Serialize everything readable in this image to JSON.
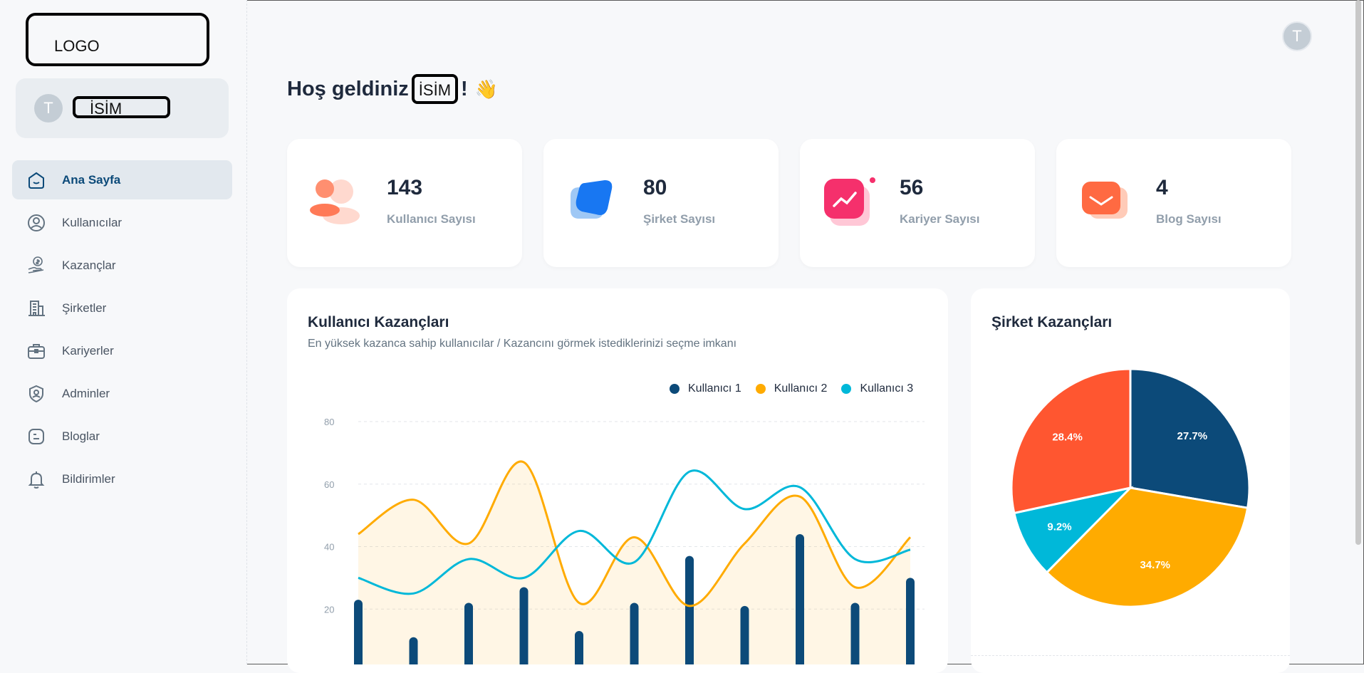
{
  "sidebar": {
    "logo": "LOGO",
    "profile": {
      "avatar_initial": "T",
      "name": "İSİM"
    },
    "items": [
      {
        "label": "Ana Sayfa",
        "icon": "home-icon",
        "active": true
      },
      {
        "label": "Kullanıcılar",
        "icon": "user-circle-icon",
        "active": false
      },
      {
        "label": "Kazançlar",
        "icon": "money-hand-icon",
        "active": false
      },
      {
        "label": "Şirketler",
        "icon": "building-icon",
        "active": false
      },
      {
        "label": "Kariyerler",
        "icon": "briefcase-icon",
        "active": false
      },
      {
        "label": "Adminler",
        "icon": "shield-user-icon",
        "active": false
      },
      {
        "label": "Bloglar",
        "icon": "blog-icon",
        "active": false
      },
      {
        "label": "Bildirimler",
        "icon": "bell-icon",
        "active": false
      }
    ]
  },
  "header": {
    "avatar_initial": "T",
    "welcome_prefix": "Hoş geldiniz",
    "welcome_name": "İSİM",
    "welcome_suffix": "!",
    "wave": "👋"
  },
  "stats": [
    {
      "value": "143",
      "label": "Kullanıcı Sayısı",
      "icon": "users-icon"
    },
    {
      "value": "80",
      "label": "Şirket Sayısı",
      "icon": "company-icon"
    },
    {
      "value": "56",
      "label": "Kariyer Sayısı",
      "icon": "career-chart-icon"
    },
    {
      "value": "4",
      "label": "Blog Sayısı",
      "icon": "blog-mail-icon"
    }
  ],
  "user_earnings": {
    "title": "Kullanıcı Kazançları",
    "subtitle": "En yüksek kazanca sahip kullanıcılar / Kazancını görmek istediklerinizi seçme imkanı"
  },
  "company_earnings": {
    "title": "Şirket Kazançları"
  },
  "colors": {
    "series1": "#0c4a79",
    "series2": "#ffab00",
    "series3": "#00b8d9",
    "slice_red": "#ff5630"
  },
  "chart_data": [
    {
      "type": "line",
      "yticks": [
        20,
        40,
        60,
        80
      ],
      "ylim": [
        0,
        80
      ],
      "grid": true,
      "legend_placement": "top-right",
      "series": [
        {
          "name": "Kullanıcı 1",
          "kind": "bar",
          "values": [
            23,
            11,
            22,
            27,
            13,
            22,
            37,
            21,
            44,
            22,
            30
          ]
        },
        {
          "name": "Kullanıcı 2",
          "kind": "area",
          "values": [
            44,
            55,
            41,
            67,
            22,
            43,
            21,
            41,
            56,
            27,
            43
          ]
        },
        {
          "name": "Kullanıcı 3",
          "kind": "line",
          "values": [
            30,
            25,
            36,
            30,
            45,
            35,
            64,
            52,
            59,
            36,
            39
          ]
        }
      ]
    },
    {
      "type": "pie",
      "slices": [
        {
          "label": "27.7%",
          "value": 27.7,
          "color": "#0c4a79"
        },
        {
          "label": "34.7%",
          "value": 34.7,
          "color": "#ffab00"
        },
        {
          "label": "9.2%",
          "value": 9.2,
          "color": "#00b8d9"
        },
        {
          "label": "28.4%",
          "value": 28.4,
          "color": "#ff5630"
        }
      ]
    }
  ]
}
